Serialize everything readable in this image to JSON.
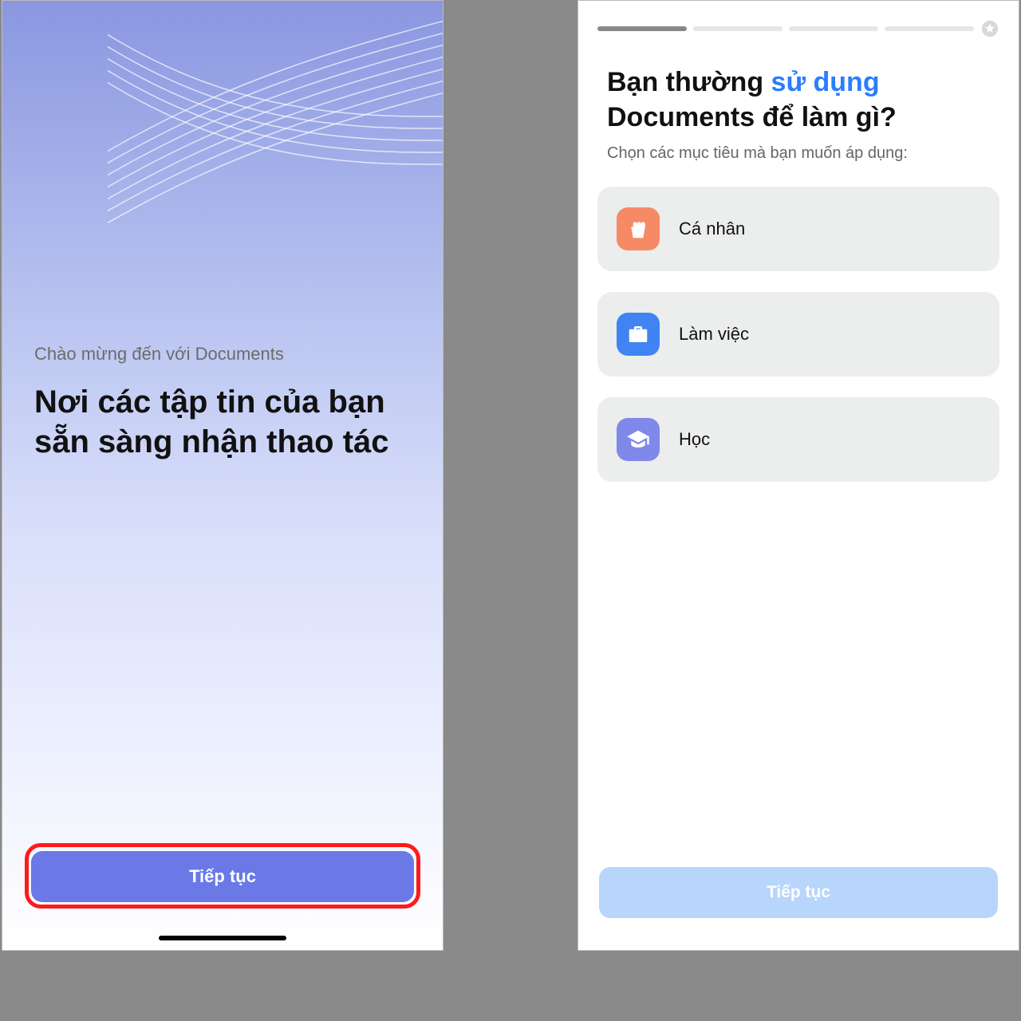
{
  "left": {
    "subtitle": "Chào mừng đến với Documents",
    "title": "Nơi các tập tin của bạn sẵn sàng nhận thao tác",
    "continue_label": "Tiếp tục"
  },
  "right": {
    "progress": {
      "segments": 4,
      "active_index": 0
    },
    "heading_before": "Bạn thường ",
    "heading_accent": "sử dụng",
    "heading_after_line1": "",
    "heading_line2": "Documents để làm gì?",
    "subheading": "Chọn các mục tiêu mà bạn muốn áp dụng:",
    "options": [
      {
        "key": "personal",
        "label": "Cá nhân",
        "icon": "popcorn-icon",
        "color": "orange"
      },
      {
        "key": "work",
        "label": "Làm việc",
        "icon": "briefcase-icon",
        "color": "blue"
      },
      {
        "key": "study",
        "label": "Học",
        "icon": "graduation-icon",
        "color": "purple"
      }
    ],
    "continue_label": "Tiếp tục"
  },
  "colors": {
    "primary_button": "#6a79e6",
    "secondary_button": "#b8d6fb",
    "accent_text": "#2b7cff",
    "highlight_border": "#ff1a1a"
  }
}
